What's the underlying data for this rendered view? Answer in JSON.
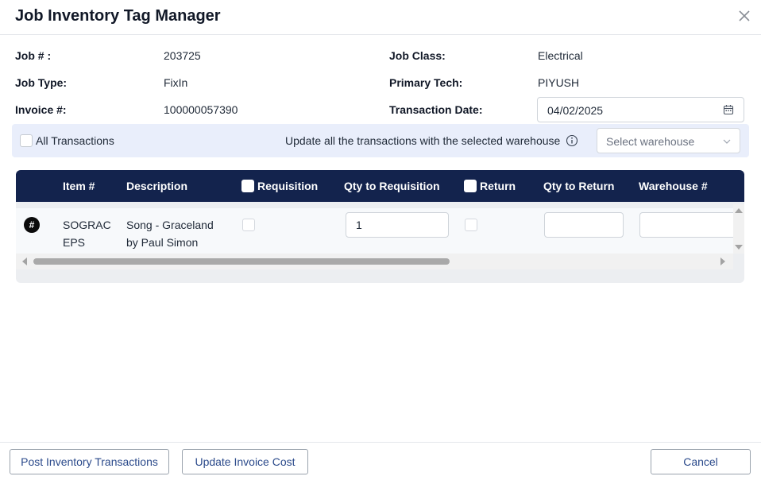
{
  "dialog": {
    "title": "Job Inventory Tag Manager"
  },
  "fields": {
    "job_no_label": "Job # :",
    "job_no_value": "203725",
    "job_type_label": "Job Type:",
    "job_type_value": "FixIn",
    "invoice_label": "Invoice #:",
    "invoice_value": "100000057390",
    "job_class_label": "Job Class:",
    "job_class_value": "Electrical",
    "primary_tech_label": "Primary Tech:",
    "primary_tech_value": "PIYUSH",
    "transaction_date_label": "Transaction Date:",
    "transaction_date_value": "04/02/2025"
  },
  "bulk": {
    "all_transactions_label": "All Transactions",
    "update_text": "Update all the transactions with the selected warehouse",
    "warehouse_placeholder": "Select warehouse"
  },
  "grid": {
    "columns": {
      "item": "Item #",
      "description": "Description",
      "requisition": "Requisition",
      "qty_to_requisition": "Qty to Requisition",
      "return": "Return",
      "qty_to_return": "Qty to Return",
      "warehouse": "Warehouse #"
    },
    "rows": [
      {
        "badge": "#",
        "item_line1": "SOGRAC",
        "item_line2": "EPS",
        "desc_line1": "Song - Graceland",
        "desc_line2": "by Paul Simon",
        "qty_to_requisition": "1",
        "qty_to_return": "",
        "warehouse": ""
      }
    ]
  },
  "footer": {
    "post_label": "Post Inventory Transactions",
    "update_cost_label": "Update Invoice Cost",
    "cancel_label": "Cancel"
  },
  "colors": {
    "header_bg": "#13234d",
    "bar_bg": "#e9eefb",
    "button_text": "#2b4a8b"
  }
}
